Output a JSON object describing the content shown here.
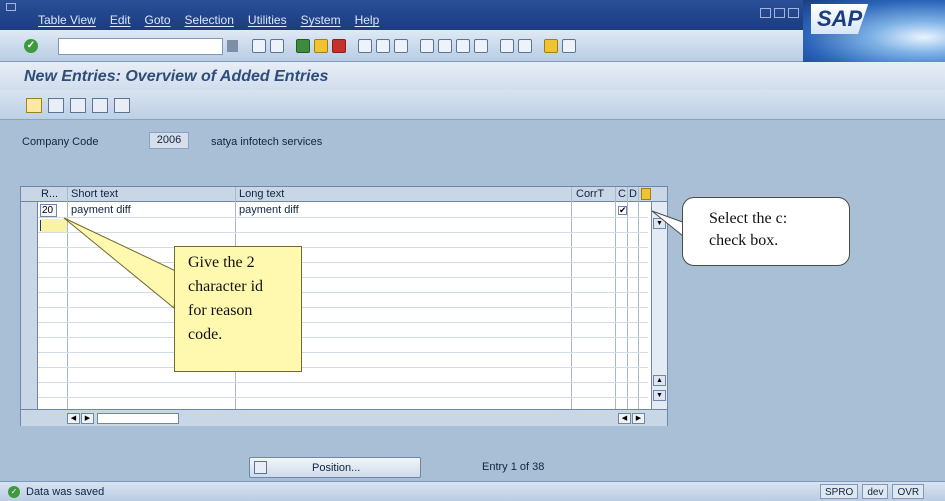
{
  "menu": {
    "items": [
      "Table View",
      "Edit",
      "Goto",
      "Selection",
      "Utilities",
      "System",
      "Help"
    ]
  },
  "logo": "SAP",
  "title": "New Entries: Overview of Added Entries",
  "company": {
    "label": "Company Code",
    "code": "2006",
    "name": "satya infotech services"
  },
  "table": {
    "headers": {
      "reason": "R...",
      "short": "Short text",
      "long": "Long text",
      "corr": "CorrT",
      "c": "C",
      "d": "D"
    },
    "rows": [
      {
        "reason": "20",
        "short": "payment diff",
        "long": "payment diff",
        "c_checked": true
      }
    ]
  },
  "callouts": {
    "left": [
      "Give the 2",
      "character id",
      "for reason",
      "code."
    ],
    "right": [
      "Select the c:",
      "check box."
    ]
  },
  "position_button": "Position...",
  "entry_info": "Entry 1 of 38",
  "status": {
    "message": "Data was saved",
    "transaction": "SPRO",
    "system": "dev",
    "mode": "OVR"
  }
}
